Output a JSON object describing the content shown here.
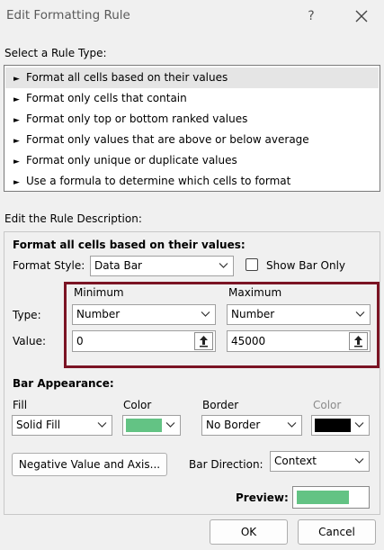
{
  "dialog": {
    "title": "Edit Formatting Rule",
    "help": "?"
  },
  "rule_type": {
    "heading": "Select a Rule Type:",
    "items": [
      "Format all cells based on their values",
      "Format only cells that contain",
      "Format only top or bottom ranked values",
      "Format only values that are above or below average",
      "Format only unique or duplicate values",
      "Use a formula to determine which cells to format"
    ],
    "selected_index": 0
  },
  "description": {
    "heading": "Edit the Rule Description:",
    "subheading": "Format all cells based on their values:",
    "format_style_label": "Format Style:",
    "format_style_value": "Data Bar",
    "show_bar_only_label": "Show Bar Only",
    "show_bar_only_checked": false,
    "minimum_label": "Minimum",
    "maximum_label": "Maximum",
    "type_label": "Type:",
    "value_label": "Value:",
    "min_type": "Number",
    "max_type": "Number",
    "min_value": "0",
    "max_value": "45000",
    "bar_appearance_label": "Bar Appearance:",
    "fill_label": "Fill",
    "fill_value": "Solid Fill",
    "color_label": "Color",
    "fill_color": "#63c384",
    "border_label": "Border",
    "border_value": "No Border",
    "border_color_label": "Color",
    "border_color": "#000000",
    "negative_button": "Negative Value and Axis...",
    "bar_direction_label": "Bar Direction:",
    "bar_direction_value": "Context",
    "preview_label": "Preview:"
  },
  "footer": {
    "ok": "OK",
    "cancel": "Cancel"
  }
}
